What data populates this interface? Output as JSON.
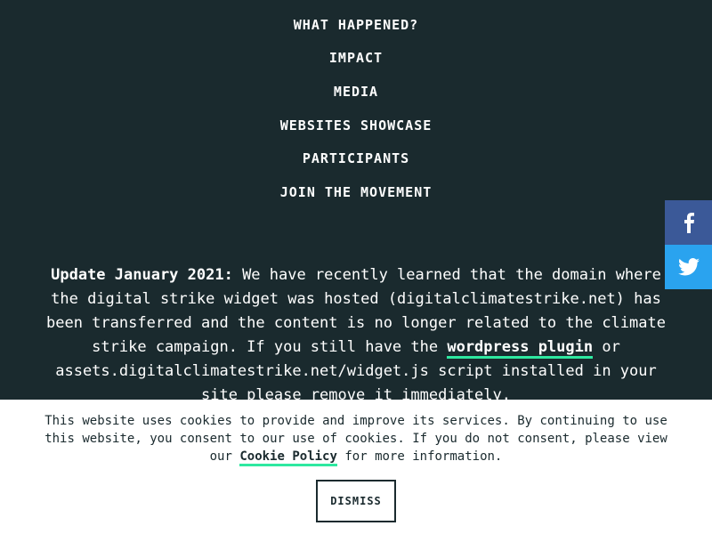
{
  "nav": {
    "items": [
      {
        "label": "WHAT HAPPENED?"
      },
      {
        "label": "IMPACT"
      },
      {
        "label": "MEDIA"
      },
      {
        "label": "WEBSITES SHOWCASE"
      },
      {
        "label": "PARTICIPANTS"
      },
      {
        "label": "JOIN THE MOVEMENT"
      }
    ]
  },
  "notice": {
    "heading": "Update January 2021:",
    "text_1": " We have recently learned that the domain where the digital strike widget was hosted (digitalclimatestrike.net) has been transferred and the content is no longer related to the climate strike campaign. If you still have the ",
    "plugin_link": "wordpress plugin",
    "text_2": " or assets.digitalclimatestrike.net/widget.js script installed in your site please remove it immediately."
  },
  "social": {
    "facebook_icon": "facebook-icon",
    "twitter_icon": "twitter-icon",
    "facebook_color": "#3b5998",
    "twitter_color": "#2aa3ef"
  },
  "cookie_bar": {
    "text": "This website uses cookies to provide and improve its services. By continuing to use this website, you consent to our use of cookies. If you do not consent, please view our ",
    "policy_link": "Cookie Policy",
    "text_end": " for more information.",
    "dismiss_label": "DISMISS"
  },
  "colors": {
    "background": "#1a2a2e",
    "accent": "#2ee8a0"
  }
}
